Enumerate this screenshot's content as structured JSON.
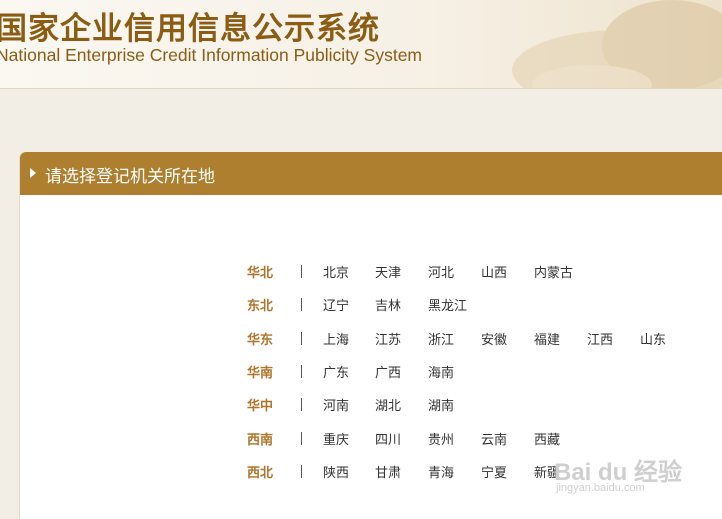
{
  "header": {
    "title_cn": "国家企业信用信息公示系统",
    "title_en": "National Enterprise Credit Information Publicity System"
  },
  "panel": {
    "title": "请选择登记机关所在地"
  },
  "regions": [
    {
      "name": "华北",
      "provinces": [
        "北京",
        "天津",
        "河北",
        "山西",
        "内蒙古"
      ]
    },
    {
      "name": "东北",
      "provinces": [
        "辽宁",
        "吉林",
        "黑龙江"
      ]
    },
    {
      "name": "华东",
      "provinces": [
        "上海",
        "江苏",
        "浙江",
        "安徽",
        "福建",
        "江西",
        "山东"
      ]
    },
    {
      "name": "华南",
      "provinces": [
        "广东",
        "广西",
        "海南"
      ]
    },
    {
      "name": "华中",
      "provinces": [
        "河南",
        "湖北",
        "湖南"
      ]
    },
    {
      "name": "西南",
      "provinces": [
        "重庆",
        "四川",
        "贵州",
        "云南",
        "西藏"
      ]
    },
    {
      "name": "西北",
      "provinces": [
        "陕西",
        "甘肃",
        "青海",
        "宁夏",
        "新疆"
      ]
    }
  ],
  "watermark": {
    "logo": "Bai du 经验",
    "url": "jingyan.baidu.com"
  },
  "colors": {
    "brand": "#8b5d14",
    "panel_header": "#ad7f2e",
    "region_label": "#b0742a",
    "background": "#f3eee5"
  }
}
